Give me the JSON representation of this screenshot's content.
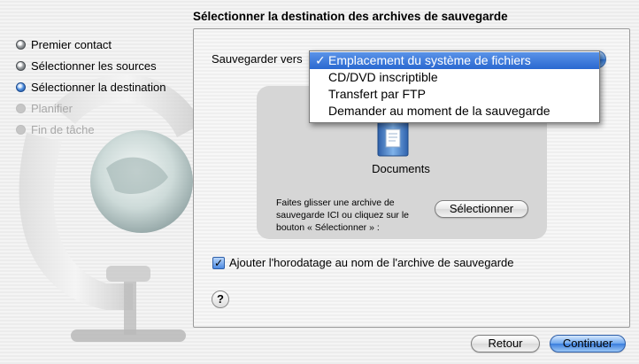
{
  "header": {
    "title": "Sélectionner la destination des archives de sauvegarde"
  },
  "steps": [
    {
      "label": "Premier contact",
      "state": "done"
    },
    {
      "label": "Sélectionner les sources",
      "state": "done"
    },
    {
      "label": "Sélectionner la destination",
      "state": "active"
    },
    {
      "label": "Planifier",
      "state": "pending"
    },
    {
      "label": "Fin de tâche",
      "state": "pending"
    }
  ],
  "destination": {
    "label": "Sauvegarder vers",
    "options": [
      "Emplacement du système de fichiers",
      "CD/DVD inscriptible",
      "Transfert par FTP",
      "Demander au moment de la sauvegarde"
    ],
    "selected_index": 0,
    "check_glyph": "✓"
  },
  "dropzone": {
    "icon": "documents-folder-icon",
    "folder_label": "Documents",
    "hint": "Faites glisser une archive de sauvegarde ICI ou cliquez sur le bouton « Sélectionner » :",
    "select_button": "Sélectionner"
  },
  "timestamp_option": {
    "label": "Ajouter l'horodatage au nom de l'archive de sauvegarde",
    "checked": true,
    "check_glyph": "✓"
  },
  "help": {
    "glyph": "?"
  },
  "footer": {
    "back_label": "Retour",
    "next_label": "Continuer"
  },
  "colors": {
    "accent": "#3a7ddd",
    "selection": "#2a68d0"
  }
}
